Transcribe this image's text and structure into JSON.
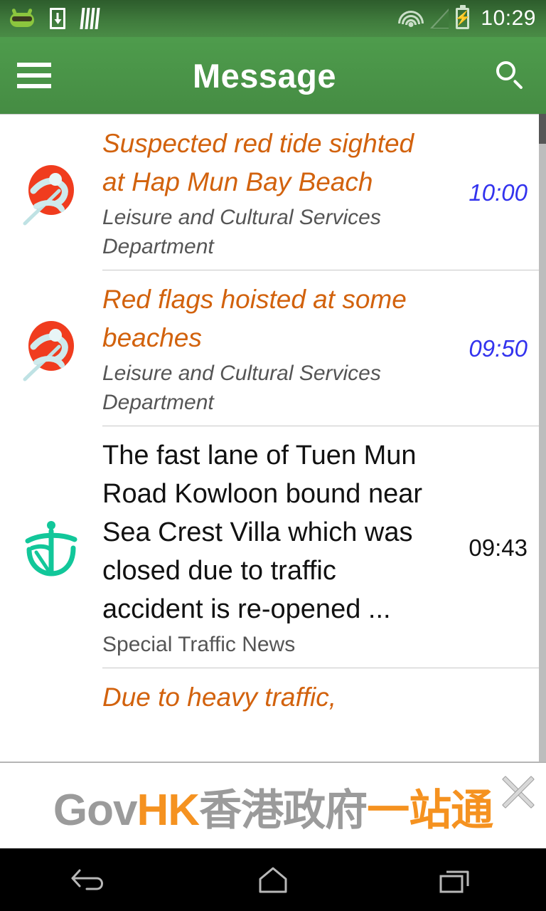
{
  "statusbar": {
    "time": "10:29",
    "icons": [
      "mascot-icon",
      "download-icon",
      "barcode-icon",
      "wifi-icon",
      "signal-icon",
      "battery-charging-icon"
    ]
  },
  "appbar": {
    "title": "Message",
    "menu_icon": "hamburger-menu-icon",
    "search_icon": "search-icon"
  },
  "messages": [
    {
      "title": "Suspected red tide sighted at Hap Mun Bay Beach",
      "source": "Leisure and Cultural Services Department",
      "time": "10:00",
      "icon": "lcsd-logo",
      "unread": true
    },
    {
      "title": "Red flags hoisted at some beaches",
      "source": "Leisure and Cultural Services Department",
      "time": "09:50",
      "icon": "lcsd-logo",
      "unread": true
    },
    {
      "title": "The fast lane of Tuen Mun Road Kowloon bound near Sea Crest Villa which was closed due to traffic accident is re-opened ...",
      "source": "Special Traffic News",
      "time": "09:43",
      "icon": "transport-department-logo",
      "unread": false
    },
    {
      "title": "Due to heavy traffic,",
      "source": "",
      "time": "",
      "icon": "transport-department-logo",
      "unread": true
    }
  ],
  "ad": {
    "gov": "Gov",
    "hk": "HK",
    "chinese_gray": "香港政府",
    "chinese_orange": "一站通",
    "close_icon": "close-icon"
  },
  "navbar": {
    "back": "back-icon",
    "home": "home-icon",
    "recents": "recents-icon"
  },
  "colors": {
    "appbar_green": "#4a9448",
    "status_green": "#3f7a3c",
    "unread_title": "#d2620d",
    "unread_time": "#3333ee",
    "read_title": "#111111",
    "source_gray": "#555555",
    "ad_orange": "#f59220",
    "ad_gray": "#9b9b9b",
    "lcsd_red": "#f03c1e",
    "td_teal": "#12c79a"
  }
}
